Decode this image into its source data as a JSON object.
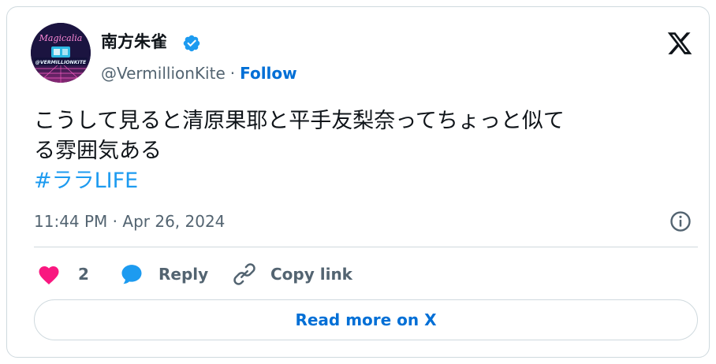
{
  "author": {
    "display_name": "南方朱雀",
    "handle": "@VermillionKite",
    "verified": true,
    "separator": "·",
    "follow_label": "Follow",
    "avatar_text_top": "Magicalia",
    "avatar_text_bottom": "@VERMILLIONKITE"
  },
  "tweet": {
    "text_line1": "こうして見ると清原果耶と平手友梨奈ってちょっと似て",
    "text_line2": "る雰囲気ある",
    "hashtag": "#ララLIFE",
    "timestamp": "11:44 PM · Apr 26, 2024"
  },
  "actions": {
    "like_count": "2",
    "reply_label": "Reply",
    "copy_link_label": "Copy link"
  },
  "read_more_label": "Read more on X",
  "colors": {
    "accent_link": "#006fd6",
    "hashtag": "#1d9bf0",
    "verified_badge": "#1d9bf0",
    "like_heart": "#f91880",
    "reply_bubble": "#1d9bf0",
    "muted_text": "#536471",
    "primary_text": "#0f1419",
    "border": "#cfd9de"
  },
  "icons": {
    "verified": "verified-badge-icon",
    "logo": "x-logo-icon",
    "info": "info-icon",
    "like": "heart-icon",
    "reply": "speech-bubble-icon",
    "copy_link": "link-icon"
  }
}
